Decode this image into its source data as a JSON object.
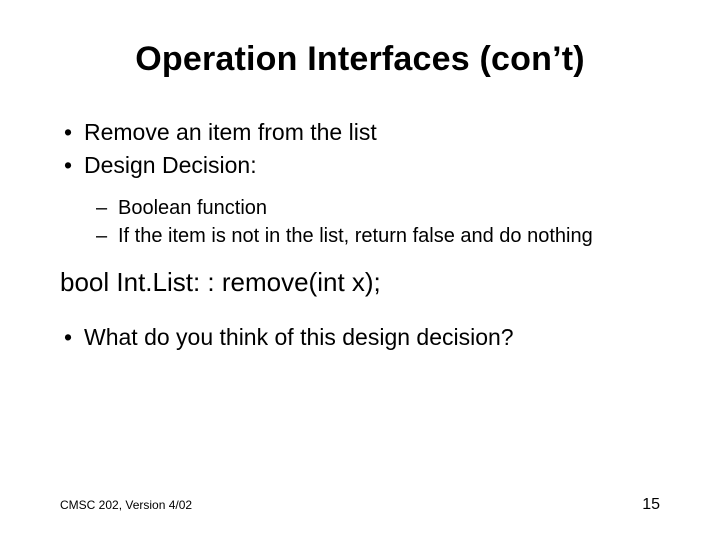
{
  "title": "Operation Interfaces (con’t)",
  "l1": {
    "a": "Remove an item from the list",
    "b": "Design Decision:",
    "c": "What do you think of this design decision?"
  },
  "l2": {
    "a": "Boolean function",
    "b": "If the item is not in the list, return false and do nothing"
  },
  "code": "bool Int.List: : remove(int x);",
  "footer": {
    "left": "CMSC 202, Version 4/02",
    "page": "15"
  }
}
